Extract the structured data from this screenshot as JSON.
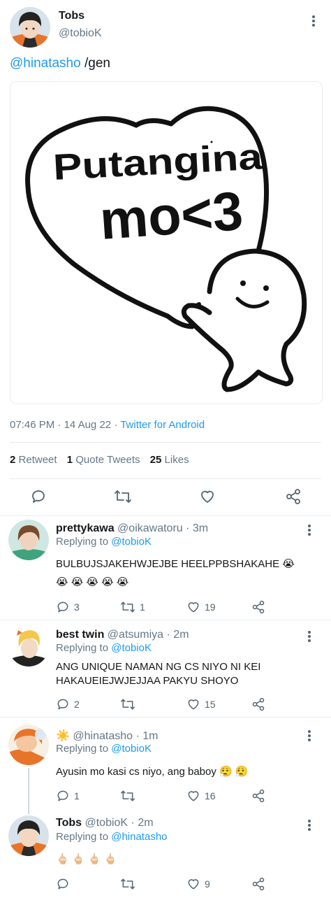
{
  "main_tweet": {
    "author_name": "Tobs",
    "author_handle": "@tobioK",
    "mention": "@hinatasho",
    "text": "/gen",
    "image": {
      "drawn_text_line1": "Putangina",
      "drawn_text_line2": "mo<3"
    },
    "time": "07:46 PM",
    "date": "14 Aug 22",
    "source": "Twitter for Android",
    "separator": "·",
    "stats": {
      "retweets_count": "2",
      "retweets_label": "Retweet",
      "quotes_count": "1",
      "quotes_label": "Quote Tweets",
      "likes_count": "25",
      "likes_label": "Likes"
    }
  },
  "replies": [
    {
      "name": "prettykawa",
      "handle": "@oikawatoru",
      "time": "· 3m",
      "replying_prefix": "Replying to",
      "replying_to": "@tobioK",
      "text_line1": "BULBUJSJAKEHWJEJBE HEELPPBSHAKAHE 😭",
      "text_line2": "😭 😭 😭 😭 😭",
      "reply_count": "3",
      "retweet_count": "1",
      "like_count": "19"
    },
    {
      "name": "best twin",
      "handle": "@atsumiya",
      "time": "· 2m",
      "replying_prefix": "Replying to",
      "replying_to": "@tobioK",
      "text_line1": "ANG UNIQUE NAMAN NG CS NIYO NI KEI",
      "text_line2": "HAKAUEIEJWJEJJAA PAKYU SHOYO",
      "reply_count": "2",
      "retweet_count": "",
      "like_count": "15"
    },
    {
      "name": "☀️",
      "handle": "@hinatasho",
      "time": "· 1m",
      "replying_prefix": "Replying to",
      "replying_to": "@tobioK",
      "text_line1": "Ayusin mo kasi cs niyo, ang baboy 😮‍💨 😮‍💨",
      "reply_count": "1",
      "retweet_count": "",
      "like_count": "16"
    },
    {
      "name": "Tobs",
      "handle": "@tobioK",
      "time": "· 2m",
      "replying_prefix": "Replying to",
      "replying_to": "@hinatasho",
      "text_line1": "🖕🏻 🖕🏻 🖕🏻 🖕🏻",
      "reply_count": "",
      "retweet_count": "",
      "like_count": "9"
    }
  ],
  "icons": [
    "more-vertical-icon",
    "reply-icon",
    "retweet-icon",
    "like-icon",
    "share-icon"
  ],
  "colors": {
    "link": "#1d9bf0",
    "muted": "#657786",
    "text": "#14171a",
    "divider": "#e6ecf0"
  }
}
